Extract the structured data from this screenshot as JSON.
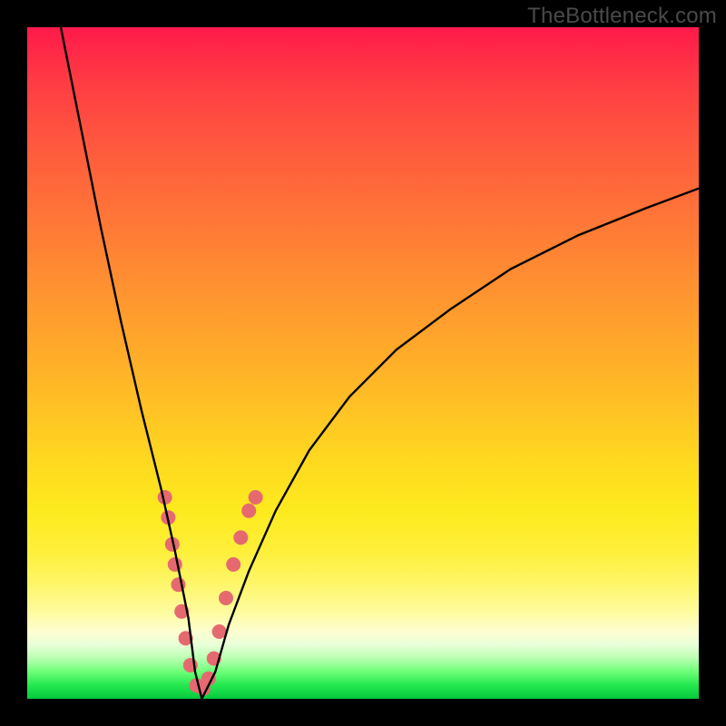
{
  "watermark": "TheBottleneck.com",
  "colors": {
    "frame": "#000000",
    "curve": "#000000",
    "dot": "#e56a6f"
  },
  "chart_data": {
    "type": "line",
    "title": "",
    "xlabel": "",
    "ylabel": "",
    "xlim": [
      0,
      100
    ],
    "ylim": [
      0,
      100
    ],
    "grid": false,
    "legend": false,
    "note": "Deep V-shaped bottleneck curve on red→green vertical gradient. Minimum near x≈25. Left branch from (5,100) down steeply; right branch rises asymptotically toward ~75 at x=100. Axes unlabeled; no ticks.",
    "series": [
      {
        "name": "bottleneck-curve",
        "x": [
          5,
          8,
          11,
          14,
          17,
          20,
          22,
          24,
          25,
          26,
          28,
          30,
          33,
          37,
          42,
          48,
          55,
          63,
          72,
          82,
          92,
          100
        ],
        "y": [
          100,
          85,
          70,
          56,
          43,
          31,
          22,
          12,
          4,
          0,
          4,
          11,
          19,
          28,
          37,
          45,
          52,
          58,
          64,
          69,
          73,
          76
        ]
      }
    ],
    "markers": {
      "name": "scatter-dots",
      "note": "Coral dots clustered along lower part of both branches near the V minimum.",
      "points": [
        {
          "x": 20.5,
          "y": 30
        },
        {
          "x": 21.0,
          "y": 27
        },
        {
          "x": 21.6,
          "y": 23
        },
        {
          "x": 22.0,
          "y": 20
        },
        {
          "x": 22.5,
          "y": 17
        },
        {
          "x": 23.0,
          "y": 13
        },
        {
          "x": 23.6,
          "y": 9
        },
        {
          "x": 24.3,
          "y": 5
        },
        {
          "x": 25.2,
          "y": 2
        },
        {
          "x": 26.2,
          "y": 1.5
        },
        {
          "x": 27.0,
          "y": 3
        },
        {
          "x": 27.8,
          "y": 6
        },
        {
          "x": 28.6,
          "y": 10
        },
        {
          "x": 29.6,
          "y": 15
        },
        {
          "x": 30.7,
          "y": 20
        },
        {
          "x": 31.8,
          "y": 24
        },
        {
          "x": 33.0,
          "y": 28
        },
        {
          "x": 34.0,
          "y": 30
        }
      ],
      "radius": 8
    }
  }
}
